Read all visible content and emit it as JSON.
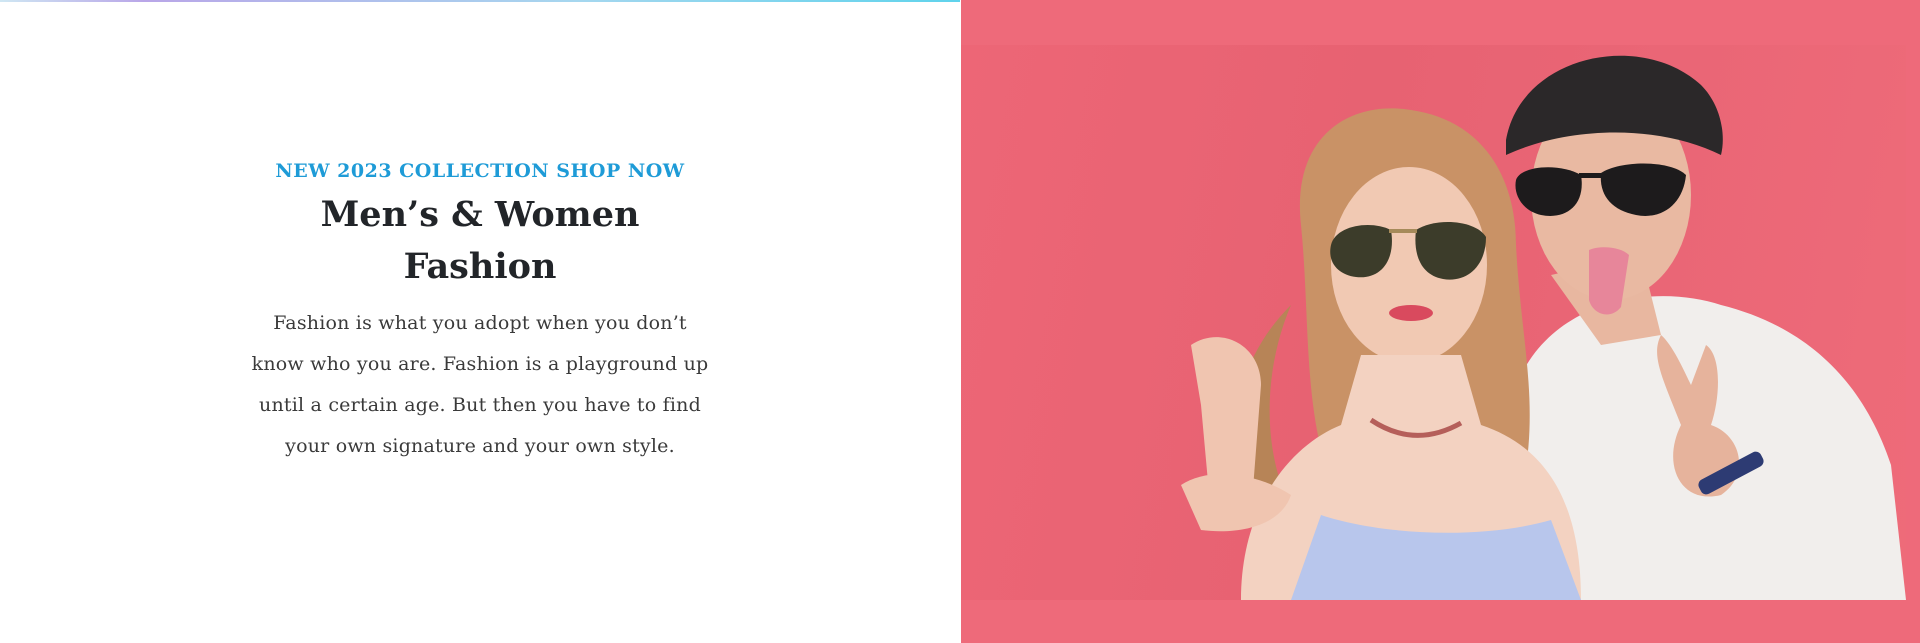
{
  "hero": {
    "eyebrow": "NEW 2023 COLLECTION SHOP NOW",
    "title": "Men’s & Women Fashion",
    "description": "Fashion is what you adopt when you don’t know who you are. Fashion is a playground up until a certain age. But then you have to find your own signature and your own style."
  },
  "image": {
    "subject": "couple-wearing-sunglasses-photo",
    "background_color": "#EE6A7A"
  },
  "colors": {
    "accent": "#1E9BD7",
    "heading": "#222529",
    "body_text": "#3A3A3A"
  }
}
